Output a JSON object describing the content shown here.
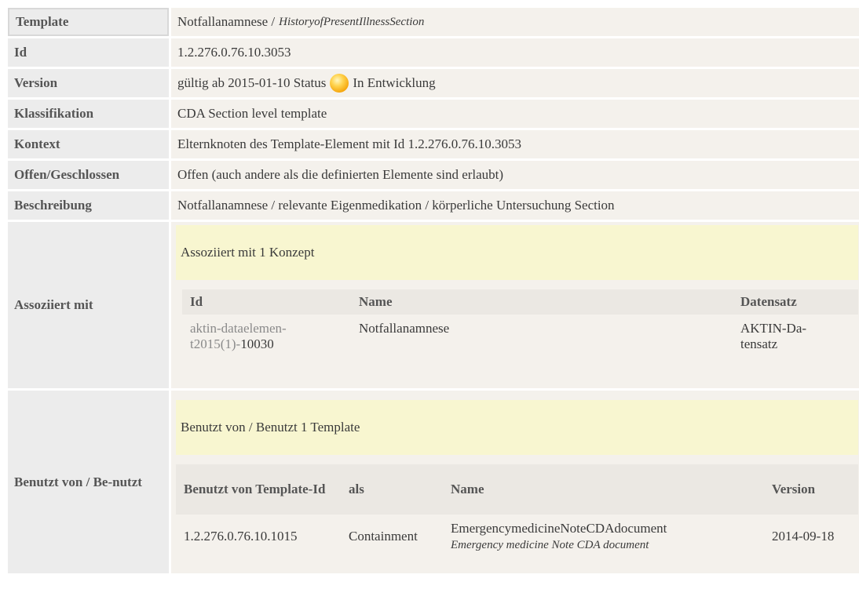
{
  "rows": {
    "template": {
      "label": "Template",
      "value": "Notfallanamnese /",
      "italic": "HistoryofPresentIllnessSection"
    },
    "id": {
      "label": "Id",
      "value": "1.2.276.0.76.10.3053"
    },
    "version": {
      "label": "Version",
      "prefix": "gültig ab 2015-01-10 Status",
      "status": "In Entwicklung",
      "status_color": "#f5b316"
    },
    "klassifikation": {
      "label": "Klassifikation",
      "value": "CDA Section level template"
    },
    "kontext": {
      "label": "Kontext",
      "value": "Elternknoten des Template-Element mit Id 1.2.276.0.76.10.3053"
    },
    "offen": {
      "label": "Offen/Geschlossen",
      "value": "Offen (auch andere als die definierten Elemente sind erlaubt)"
    },
    "beschreibung": {
      "label": "Beschreibung",
      "value": "Notfallanamnese / relevante Eigenmedikation / körperliche Untersuchung Section"
    }
  },
  "assoziiert": {
    "label": "Assoziiert mit",
    "header": "Assoziiert mit 1 Konzept",
    "columns": [
      "Id",
      "Name",
      "Datensatz"
    ],
    "row": {
      "id_line1": "aktin-dataelemen-",
      "id_line2_grey": "t2015(1)-",
      "id_line2_dark": "10030",
      "name": "Notfallanamnese",
      "datensatz_line1": "AKTIN-Da-",
      "datensatz_line2": "tensatz"
    }
  },
  "benutzt": {
    "label": "Benutzt von / Be-nutzt",
    "header": "Benutzt von / Benutzt 1 Template",
    "columns": [
      "Benutzt von Template-Id",
      "als",
      "Name",
      "Version"
    ],
    "row": {
      "template_id": "1.2.276.0.76.10.1015",
      "als": "Containment",
      "name": "EmergencymedicineNoteCDAdocument",
      "name_italic": "Emergency medicine Note CDA document",
      "version": "2014-09-18"
    }
  }
}
